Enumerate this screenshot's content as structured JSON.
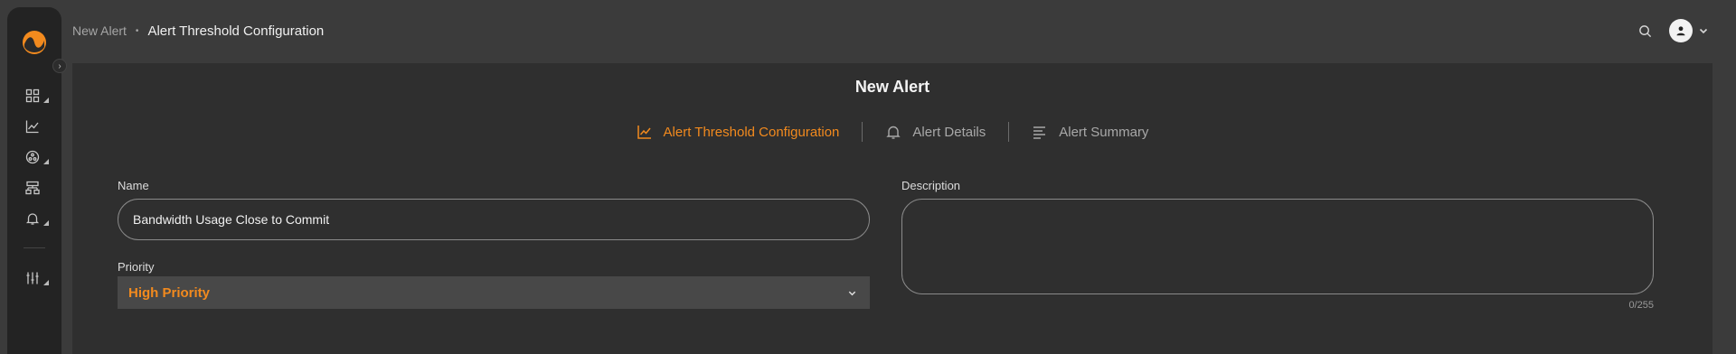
{
  "breadcrumb": {
    "parent": "New Alert",
    "separator": "•",
    "current": "Alert Threshold Configuration"
  },
  "sidebar": {
    "items": [
      {
        "icon": "dashboard-icon",
        "has_submenu": true
      },
      {
        "icon": "chart-icon",
        "has_submenu": false
      },
      {
        "icon": "network-icon",
        "has_submenu": true
      },
      {
        "icon": "topology-icon",
        "has_submenu": false
      },
      {
        "icon": "bell-icon",
        "has_submenu": true
      },
      {
        "icon": "sliders-icon",
        "has_submenu": true
      }
    ]
  },
  "page": {
    "title": "New Alert"
  },
  "steps": [
    {
      "label": "Alert Threshold Configuration",
      "icon": "line-chart-icon",
      "active": true
    },
    {
      "label": "Alert Details",
      "icon": "bell-icon",
      "active": false
    },
    {
      "label": "Alert Summary",
      "icon": "summary-lines-icon",
      "active": false
    }
  ],
  "form": {
    "name_label": "Name",
    "name_value": "Bandwidth Usage Close to Commit",
    "priority_label": "Priority",
    "priority_value": "High Priority",
    "description_label": "Description",
    "description_value": "",
    "char_count": "0/255"
  },
  "colors": {
    "accent": "#f28a1e",
    "background": "#3b3b3b",
    "panel": "#2f2f2f",
    "sidebar": "#232323"
  }
}
